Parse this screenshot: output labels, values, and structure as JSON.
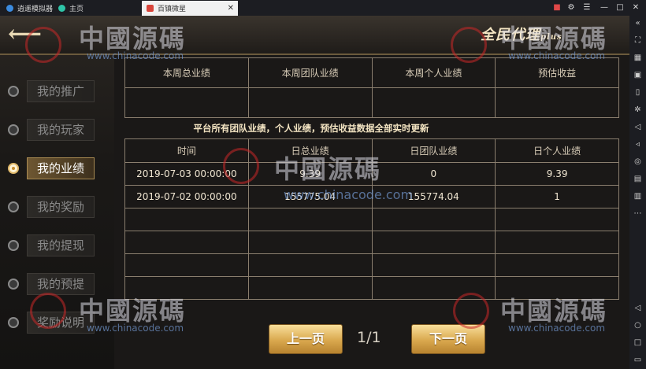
{
  "titlebar": {
    "tabs": [
      {
        "label": "逍遥模拟器",
        "active": false
      },
      {
        "label": "主页",
        "active": false
      },
      {
        "label": "百镇微星",
        "active": true
      }
    ]
  },
  "header": {
    "title_main": "全民代理",
    "title_suffix": "plus"
  },
  "sidebar": {
    "items": [
      {
        "label": "我的推广",
        "active": false
      },
      {
        "label": "我的玩家",
        "active": false
      },
      {
        "label": "我的业绩",
        "active": true
      },
      {
        "label": "我的奖励",
        "active": false
      },
      {
        "label": "我的提现",
        "active": false
      },
      {
        "label": "我的预提",
        "active": false
      },
      {
        "label": "奖励说明",
        "active": false
      }
    ]
  },
  "summary": {
    "headers": [
      "本周总业绩",
      "本周团队业绩",
      "本周个人业绩",
      "预估收益"
    ],
    "values": [
      "",
      "",
      "",
      ""
    ]
  },
  "notice": "平台所有团队业绩，个人业绩，预估收益数据全部实时更新",
  "daily": {
    "headers": [
      "时间",
      "日总业绩",
      "日团队业绩",
      "日个人业绩"
    ],
    "rows": [
      [
        "2019-07-03 00:00:00",
        "9.39",
        "0",
        "9.39"
      ],
      [
        "2019-07-02 00:00:00",
        "155775.04",
        "155774.04",
        "1"
      ],
      [
        "",
        "",
        "",
        ""
      ],
      [
        "",
        "",
        "",
        ""
      ],
      [
        "",
        "",
        "",
        ""
      ],
      [
        "",
        "",
        "",
        ""
      ]
    ]
  },
  "pager": {
    "prev_label": "上一页",
    "next_label": "下一页",
    "indicator": "1/1"
  },
  "watermark": {
    "text": "中國源碼",
    "url": "www.chinacode.com"
  },
  "colors": {
    "accent": "#e0b96a",
    "button_gold": "#d9a84e"
  }
}
